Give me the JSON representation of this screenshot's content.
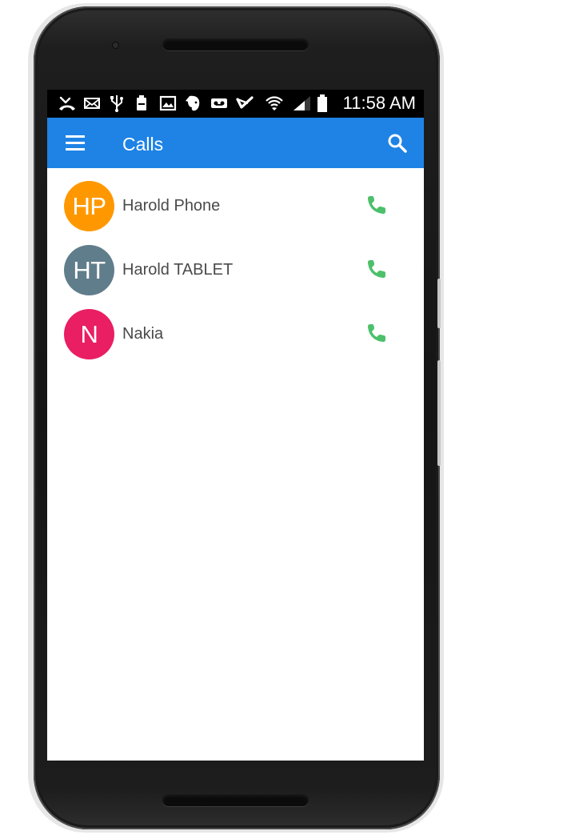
{
  "status_bar": {
    "time": "11:58 AM",
    "icons": [
      "missed-call-icon",
      "email-icon",
      "usb-icon",
      "battery-full-icon",
      "image-icon",
      "evernote-icon",
      "voicemail-icon",
      "checkmark-icon",
      "wifi-icon",
      "signal-icon",
      "battery-icon"
    ]
  },
  "app_bar": {
    "title": "Calls",
    "menu_icon": "menu-icon",
    "search_icon": "search-icon",
    "color": "#1E83E5"
  },
  "calls": [
    {
      "initials": "HP",
      "name": "Harold Phone",
      "avatar_color": "#FF9800",
      "call_icon": "phone-icon"
    },
    {
      "initials": "HT",
      "name": "Harold TABLET",
      "avatar_color": "#607D8B",
      "call_icon": "phone-icon"
    },
    {
      "initials": "N",
      "name": "Nakia",
      "avatar_color": "#E91E63",
      "call_icon": "phone-icon"
    }
  ],
  "colors": {
    "phone_icon": "#4CC06A",
    "text": "#4A4A4A"
  }
}
